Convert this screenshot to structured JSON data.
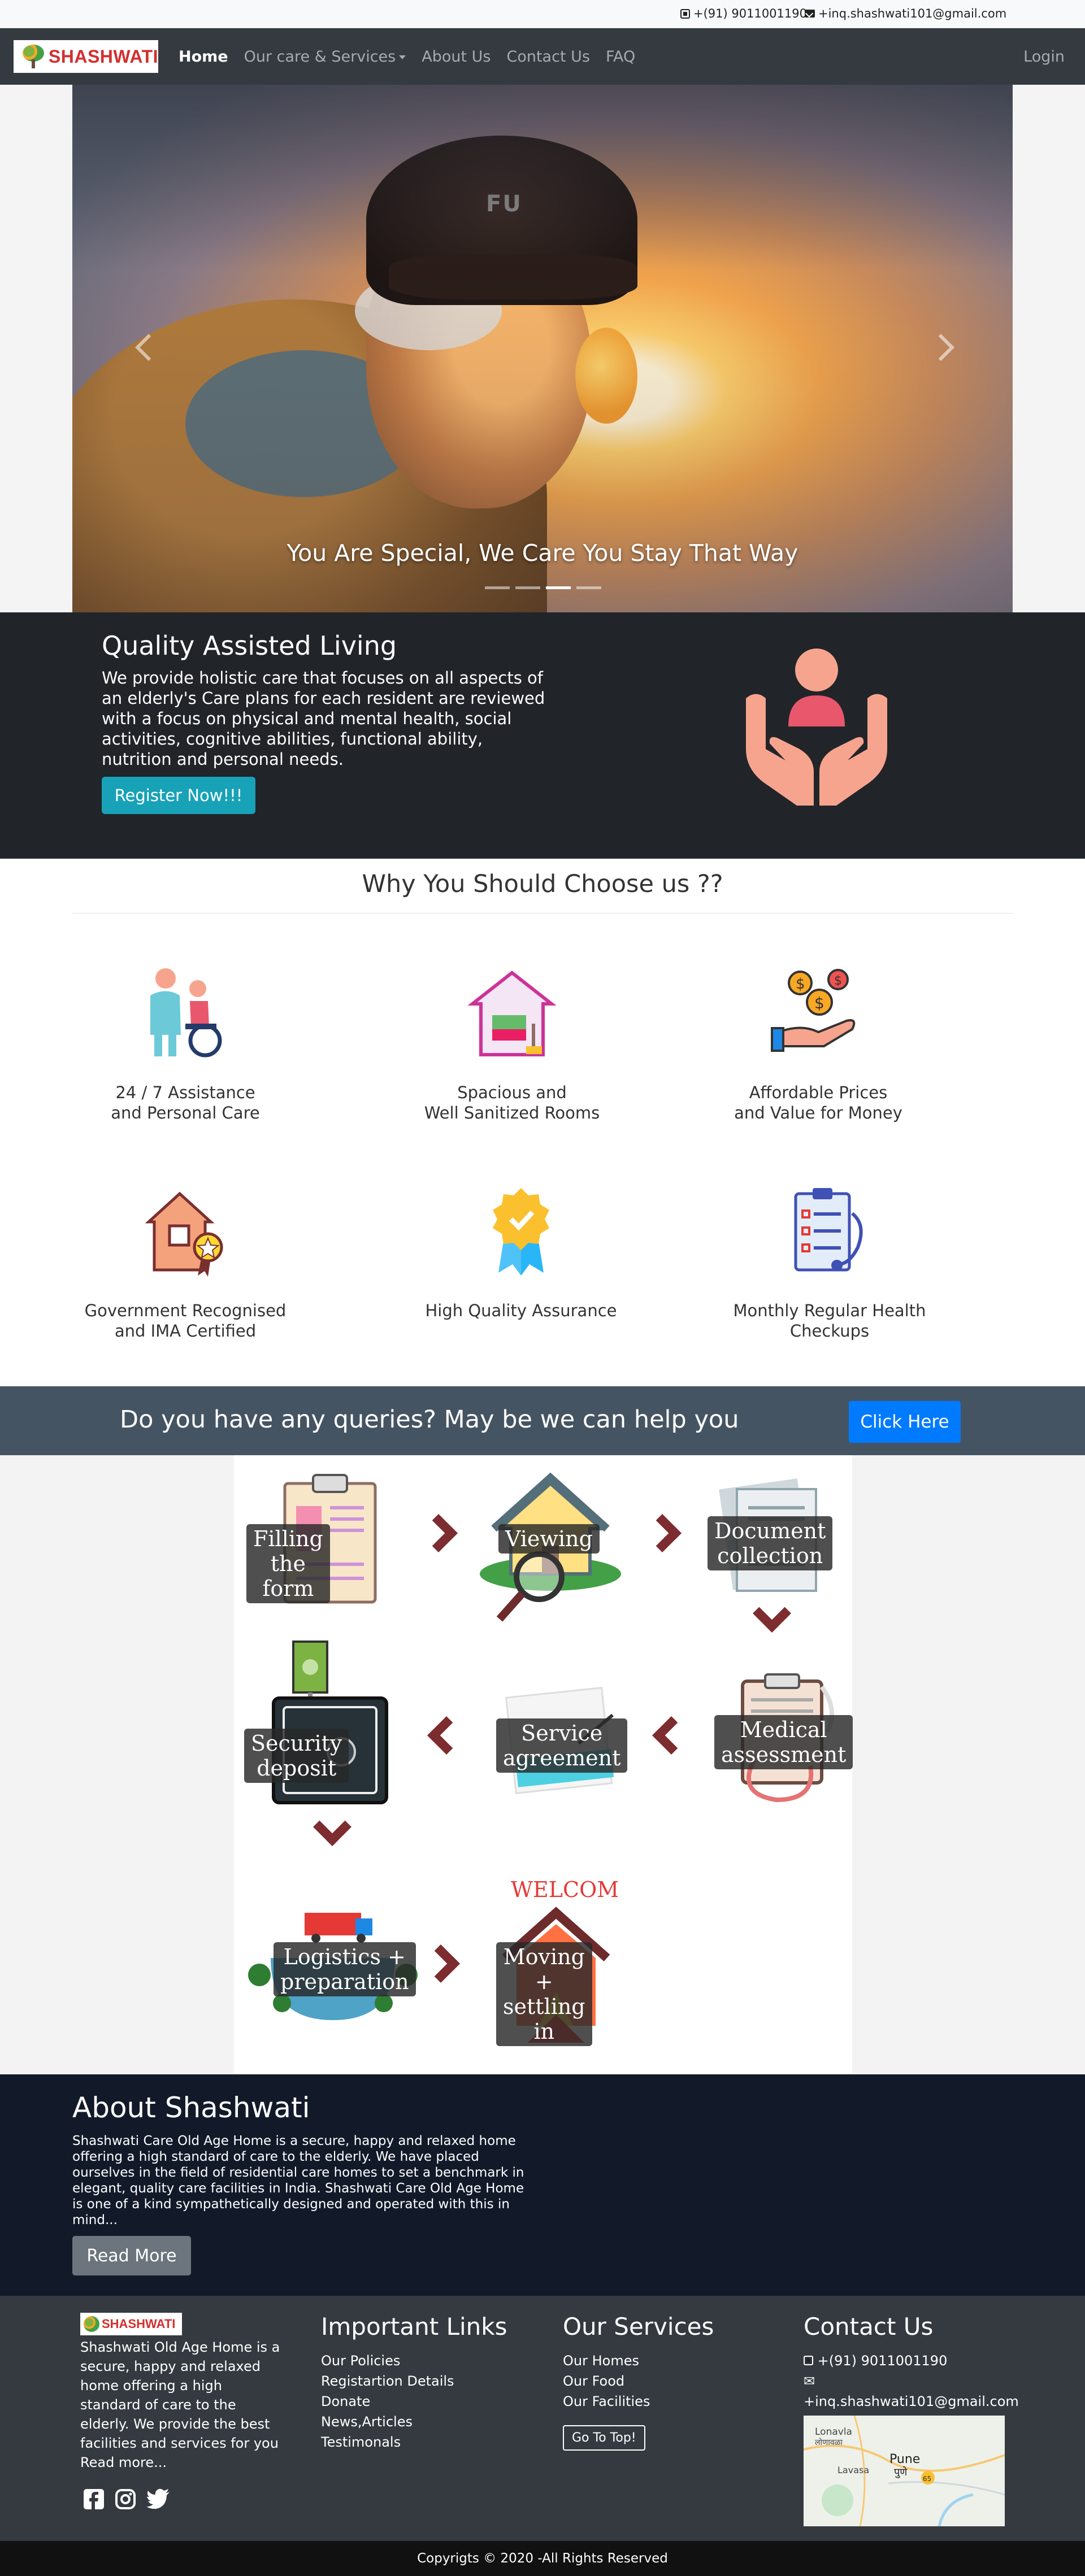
{
  "topbar": {
    "phone": "+(91) 9011001190",
    "email": "+inq.shashwati101@gmail.com"
  },
  "navbar": {
    "brand": "SHASHWATI",
    "links": [
      "Home",
      "Our care & Services",
      "About Us",
      "Contact Us",
      "FAQ"
    ],
    "active": "Home",
    "login": "Login"
  },
  "carousel": {
    "caption": "You Are Special, We Care You Stay That Way",
    "hat_text": "FU",
    "slide_count": 4,
    "active_slide": 3
  },
  "quality": {
    "title": "Quality Assisted Living",
    "text": "We provide holistic care that focuses on all aspects of an elderly's Care plans for each resident are reviewed with a focus on physical and mental health, social activities, cognitive abilities, functional ability, nutrition and personal needs.",
    "button": "Register Now!!!"
  },
  "why": {
    "title": "Why You Should Choose us ??",
    "features": [
      {
        "text": "24 / 7 Assistance\nand Personal Care",
        "icon": "caregiver-wheelchair-icon"
      },
      {
        "text": "Spacious and\nWell Sanitized Rooms",
        "icon": "clean-room-icon"
      },
      {
        "text": "Affordable Prices\nand Value for Money",
        "icon": "coins-hand-icon"
      },
      {
        "text": "Government Recognised\nand IMA Certified",
        "icon": "certified-house-icon"
      },
      {
        "text": "High Quality Assurance",
        "icon": "quality-badge-icon"
      },
      {
        "text": "Monthly Regular Health\nCheckups",
        "icon": "health-checkup-icon"
      }
    ]
  },
  "query": {
    "text": "Do you have any queries? May be we can help you",
    "button": "Click Here"
  },
  "process": {
    "steps": [
      "Filling the form",
      "Viewing",
      "Document\ncollection",
      "Medical\nassessment",
      "Service\nagreement",
      "Security deposit",
      "Logistics +\npreparation",
      "Moving +\nsettling in"
    ],
    "welcome_sign": "WELCOME"
  },
  "about": {
    "title": "About Shashwati",
    "text": "Shashwati Care Old Age Home is a secure, happy and relaxed home offering a high standard of care to the elderly. We have placed ourselves in the field of residential care homes to set a benchmark in elegant, quality care facilities in India. Shashwati Care Old Age Home is one of a kind sympathetically designed and operated with this in mind...",
    "button": "Read More"
  },
  "footer": {
    "brand": "SHASHWATI",
    "about": "Shashwati Old Age Home is a secure, happy and relaxed home offering a high standard of care to the elderly. We provide the best facilities and services for you",
    "read_more": "Read more...",
    "important_links": {
      "title": "Important Links",
      "items": [
        "Our Policies",
        "Registartion Details",
        "Donate",
        "News,Articles",
        "Testimonals"
      ]
    },
    "services": {
      "title": "Our Services",
      "items": [
        "Our Homes",
        "Our Food",
        "Our Facilities"
      ],
      "go_top": "Go To Top!"
    },
    "contact": {
      "title": "Contact Us",
      "phone": "+(91) 9011001190",
      "email": "+inq.shashwati101@gmail.com",
      "map_labels": [
        "Lonavla",
        "लोणावळा",
        "Lavasa",
        "Pune",
        "पुणे",
        "65"
      ]
    },
    "copyright": "Copyrigts © 2020 -All Rights Reserved"
  }
}
